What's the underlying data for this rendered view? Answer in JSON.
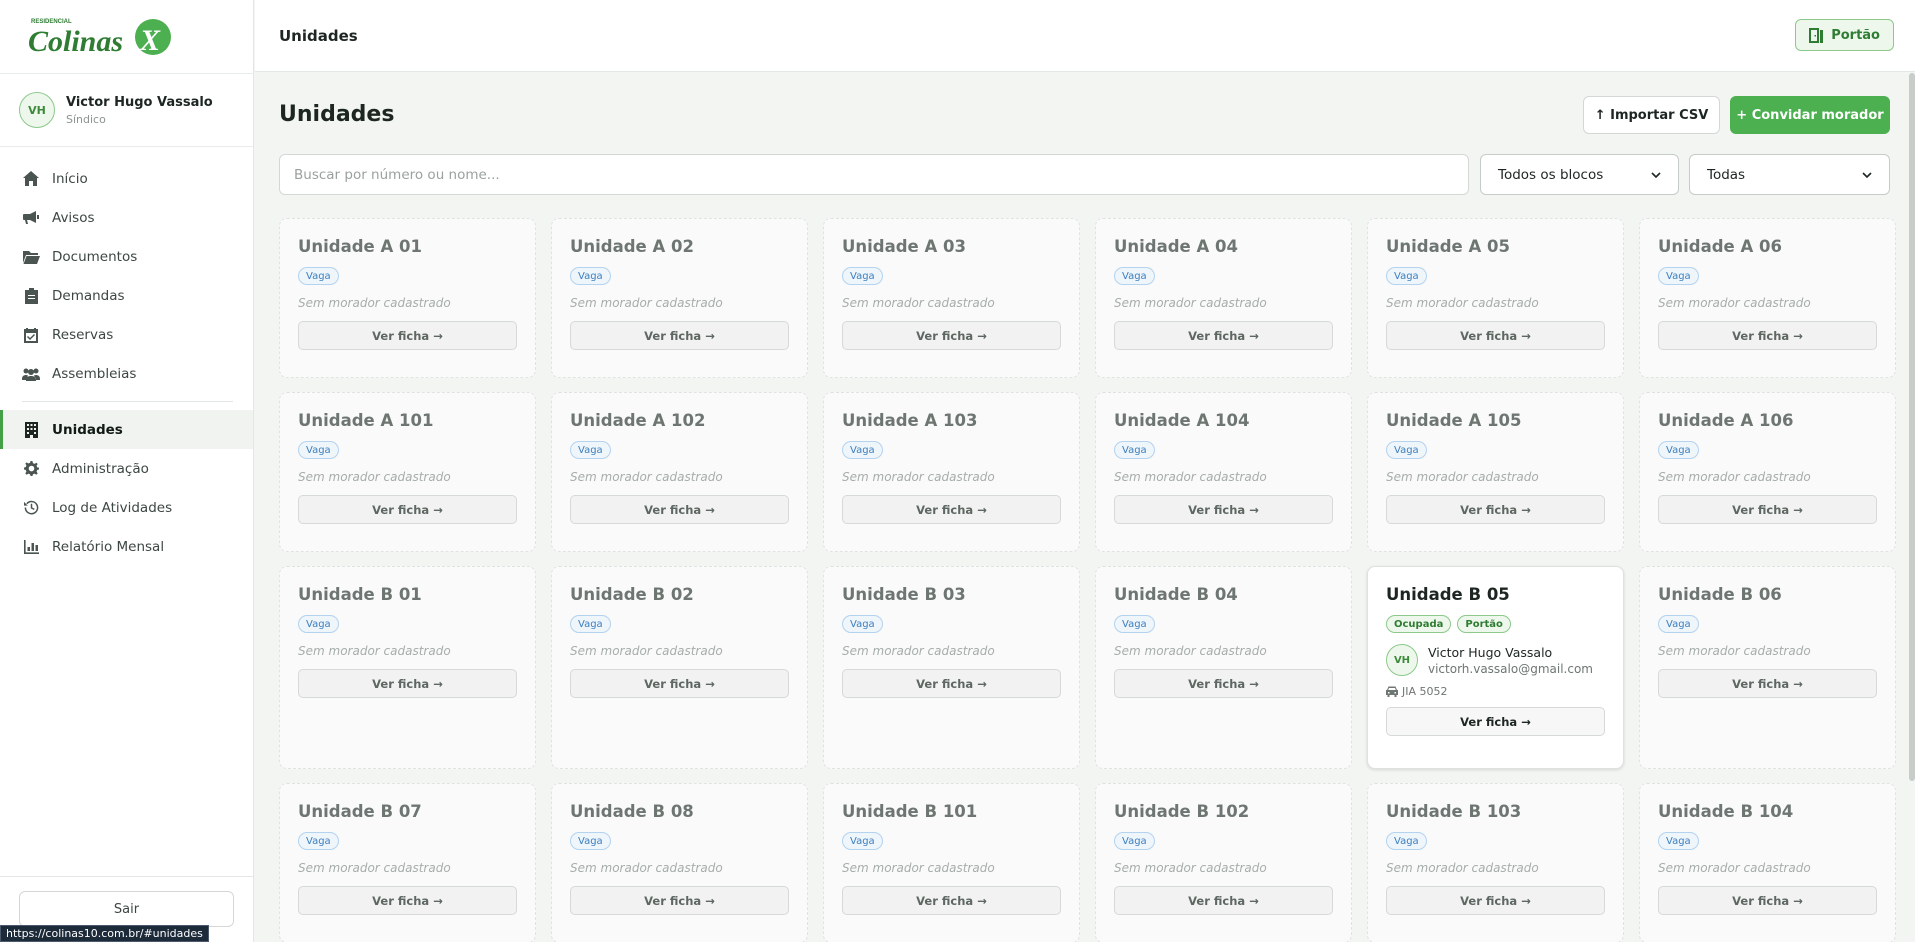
{
  "app": {
    "logo_small": "RESIDENCIAL",
    "logo_name": "Colinas"
  },
  "user": {
    "initials": "VH",
    "name": "Victor Hugo Vassalo",
    "role": "Síndico"
  },
  "nav": {
    "items": [
      {
        "label": "Início",
        "icon": "home-icon"
      },
      {
        "label": "Avisos",
        "icon": "megaphone-icon"
      },
      {
        "label": "Documentos",
        "icon": "folder-icon"
      },
      {
        "label": "Demandas",
        "icon": "clipboard-icon"
      },
      {
        "label": "Reservas",
        "icon": "calendar-icon"
      },
      {
        "label": "Assembleias",
        "icon": "users-icon"
      }
    ],
    "admin_items": [
      {
        "label": "Unidades",
        "icon": "building-icon",
        "active": true
      },
      {
        "label": "Administração",
        "icon": "gear-icon"
      },
      {
        "label": "Log de Atividades",
        "icon": "history-icon"
      },
      {
        "label": "Relatório Mensal",
        "icon": "chart-icon"
      }
    ],
    "logout": "Sair"
  },
  "status_url": "https://colinas10.com.br/#unidades",
  "topbar": {
    "title": "Unidades",
    "gate_button": "Portão"
  },
  "main": {
    "title": "Unidades",
    "import_button": "↑ Importar CSV",
    "invite_button": "+ Convidar morador",
    "search_placeholder": "Buscar por número ou nome...",
    "block_filter": "Todos os blocos",
    "status_filter": "Todas"
  },
  "labels": {
    "vacant": "Vaga",
    "no_resident": "Sem morador cadastrado",
    "view": "Ver ficha →"
  },
  "units": [
    "Unidade A 01",
    "Unidade A 02",
    "Unidade A 03",
    "Unidade A 04",
    "Unidade A 05",
    "Unidade A 06",
    "Unidade A 101",
    "Unidade A 102",
    "Unidade A 103",
    "Unidade A 104",
    "Unidade A 105",
    "Unidade A 106",
    "Unidade B 01",
    "Unidade B 02",
    "Unidade B 03",
    "Unidade B 04",
    "Unidade B 05",
    "Unidade B 06",
    "Unidade B 07",
    "Unidade B 08",
    "Unidade B 101",
    "Unidade B 102",
    "Unidade B 103",
    "Unidade B 104"
  ],
  "occupied_unit": {
    "title": "Unidade B 05",
    "badges": [
      "Ocupada",
      "Portão"
    ],
    "resident_initials": "VH",
    "resident_name": "Victor Hugo Vassalo",
    "resident_email": "victorh.vassalo@gmail.com",
    "vehicle": "JIA 5052",
    "view": "Ver ficha →"
  },
  "colors": {
    "accent": "#4caf50",
    "vacant_badge": "#3c7fbf",
    "status_green": "#2e7d32"
  }
}
